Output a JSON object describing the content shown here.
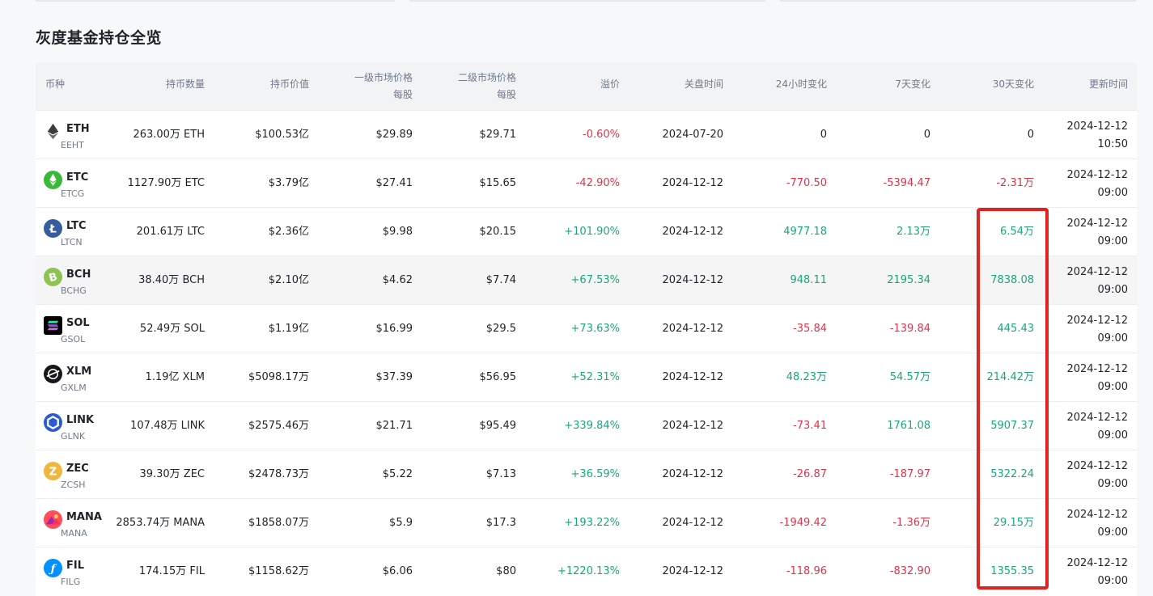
{
  "title": "灰度基金持仓全览",
  "headers": {
    "coin": "币种",
    "holdings": "持币数量",
    "value": "持币价值",
    "primary_price_l1": "一级市场价格",
    "primary_price_l2": "每股",
    "secondary_price_l1": "二级市场价格",
    "secondary_price_l2": "每股",
    "premium": "溢价",
    "close_time": "关盘时间",
    "change_24h": "24小时变化",
    "change_7d": "7天变化",
    "change_30d": "30天变化",
    "update_time": "更新时间"
  },
  "rows": [
    {
      "symbol": "ETH",
      "trust": "EEHT",
      "icon": "ethereum-icon",
      "icon_color": "#3c3c3d",
      "holdings": "263.00万 ETH",
      "value": "$100.53亿",
      "primary": "$29.89",
      "secondary": "$29.71",
      "premium": "-0.60%",
      "close": "2024-07-20",
      "c24": "0",
      "c7": "0",
      "c30": "0",
      "upd_date": "2024-12-12",
      "upd_time": "10:50"
    },
    {
      "symbol": "ETC",
      "trust": "ETCG",
      "icon": "ethereum-classic-icon",
      "icon_color": "#3ab83a",
      "holdings": "1127.90万 ETC",
      "value": "$3.79亿",
      "primary": "$27.41",
      "secondary": "$15.65",
      "premium": "-42.90%",
      "close": "2024-12-12",
      "c24": "-770.50",
      "c7": "-5394.47",
      "c30": "-2.31万",
      "upd_date": "2024-12-12",
      "upd_time": "09:00"
    },
    {
      "symbol": "LTC",
      "trust": "LTCN",
      "icon": "litecoin-icon",
      "icon_color": "#345d9d",
      "holdings": "201.61万 LTC",
      "value": "$2.36亿",
      "primary": "$9.98",
      "secondary": "$20.15",
      "premium": "+101.90%",
      "close": "2024-12-12",
      "c24": "4977.18",
      "c7": "2.13万",
      "c30": "6.54万",
      "upd_date": "2024-12-12",
      "upd_time": "09:00"
    },
    {
      "symbol": "BCH",
      "trust": "BCHG",
      "icon": "bitcoin-cash-icon",
      "icon_color": "#8dc351",
      "holdings": "38.40万 BCH",
      "value": "$2.10亿",
      "primary": "$4.62",
      "secondary": "$7.74",
      "premium": "+67.53%",
      "close": "2024-12-12",
      "c24": "948.11",
      "c7": "2195.34",
      "c30": "7838.08",
      "upd_date": "2024-12-12",
      "upd_time": "09:00"
    },
    {
      "symbol": "SOL",
      "trust": "GSOL",
      "icon": "solana-icon",
      "icon_color": "#000000",
      "holdings": "52.49万 SOL",
      "value": "$1.19亿",
      "primary": "$16.99",
      "secondary": "$29.5",
      "premium": "+73.63%",
      "close": "2024-12-12",
      "c24": "-35.84",
      "c7": "-139.84",
      "c30": "445.43",
      "upd_date": "2024-12-12",
      "upd_time": "09:00"
    },
    {
      "symbol": "XLM",
      "trust": "GXLM",
      "icon": "stellar-icon",
      "icon_color": "#14161a",
      "holdings": "1.19亿 XLM",
      "value": "$5098.17万",
      "primary": "$37.39",
      "secondary": "$56.95",
      "premium": "+52.31%",
      "close": "2024-12-12",
      "c24": "48.23万",
      "c7": "54.57万",
      "c30": "214.42万",
      "upd_date": "2024-12-12",
      "upd_time": "09:00"
    },
    {
      "symbol": "LINK",
      "trust": "GLNK",
      "icon": "chainlink-icon",
      "icon_color": "#2a5ada",
      "holdings": "107.48万 LINK",
      "value": "$2575.46万",
      "primary": "$21.71",
      "secondary": "$95.49",
      "premium": "+339.84%",
      "close": "2024-12-12",
      "c24": "-73.41",
      "c7": "1761.08",
      "c30": "5907.37",
      "upd_date": "2024-12-12",
      "upd_time": "09:00"
    },
    {
      "symbol": "ZEC",
      "trust": "ZCSH",
      "icon": "zcash-icon",
      "icon_color": "#f0b73e",
      "holdings": "39.30万 ZEC",
      "value": "$2478.73万",
      "primary": "$5.22",
      "secondary": "$7.13",
      "premium": "+36.59%",
      "close": "2024-12-12",
      "c24": "-26.87",
      "c7": "-187.97",
      "c30": "5322.24",
      "upd_date": "2024-12-12",
      "upd_time": "09:00"
    },
    {
      "symbol": "MANA",
      "trust": "MANA",
      "icon": "decentraland-icon",
      "icon_color": "#ff4d5a",
      "holdings": "2853.74万 MANA",
      "value": "$1858.07万",
      "primary": "$5.9",
      "secondary": "$17.3",
      "premium": "+193.22%",
      "close": "2024-12-12",
      "c24": "-1949.42",
      "c7": "-1.36万",
      "c30": "29.15万",
      "upd_date": "2024-12-12",
      "upd_time": "09:00"
    },
    {
      "symbol": "FIL",
      "trust": "FILG",
      "icon": "filecoin-icon",
      "icon_color": "#0090ff",
      "holdings": "174.15万 FIL",
      "value": "$1158.62万",
      "primary": "$6.06",
      "secondary": "$80",
      "premium": "+1220.13%",
      "close": "2024-12-12",
      "c24": "-118.96",
      "c7": "-832.90",
      "c30": "1355.35",
      "upd_date": "2024-12-12",
      "upd_time": "09:00"
    }
  ],
  "colors": {
    "negative": "#e0344a",
    "positive": "#1aa67c",
    "highlight": "#e0231f"
  }
}
